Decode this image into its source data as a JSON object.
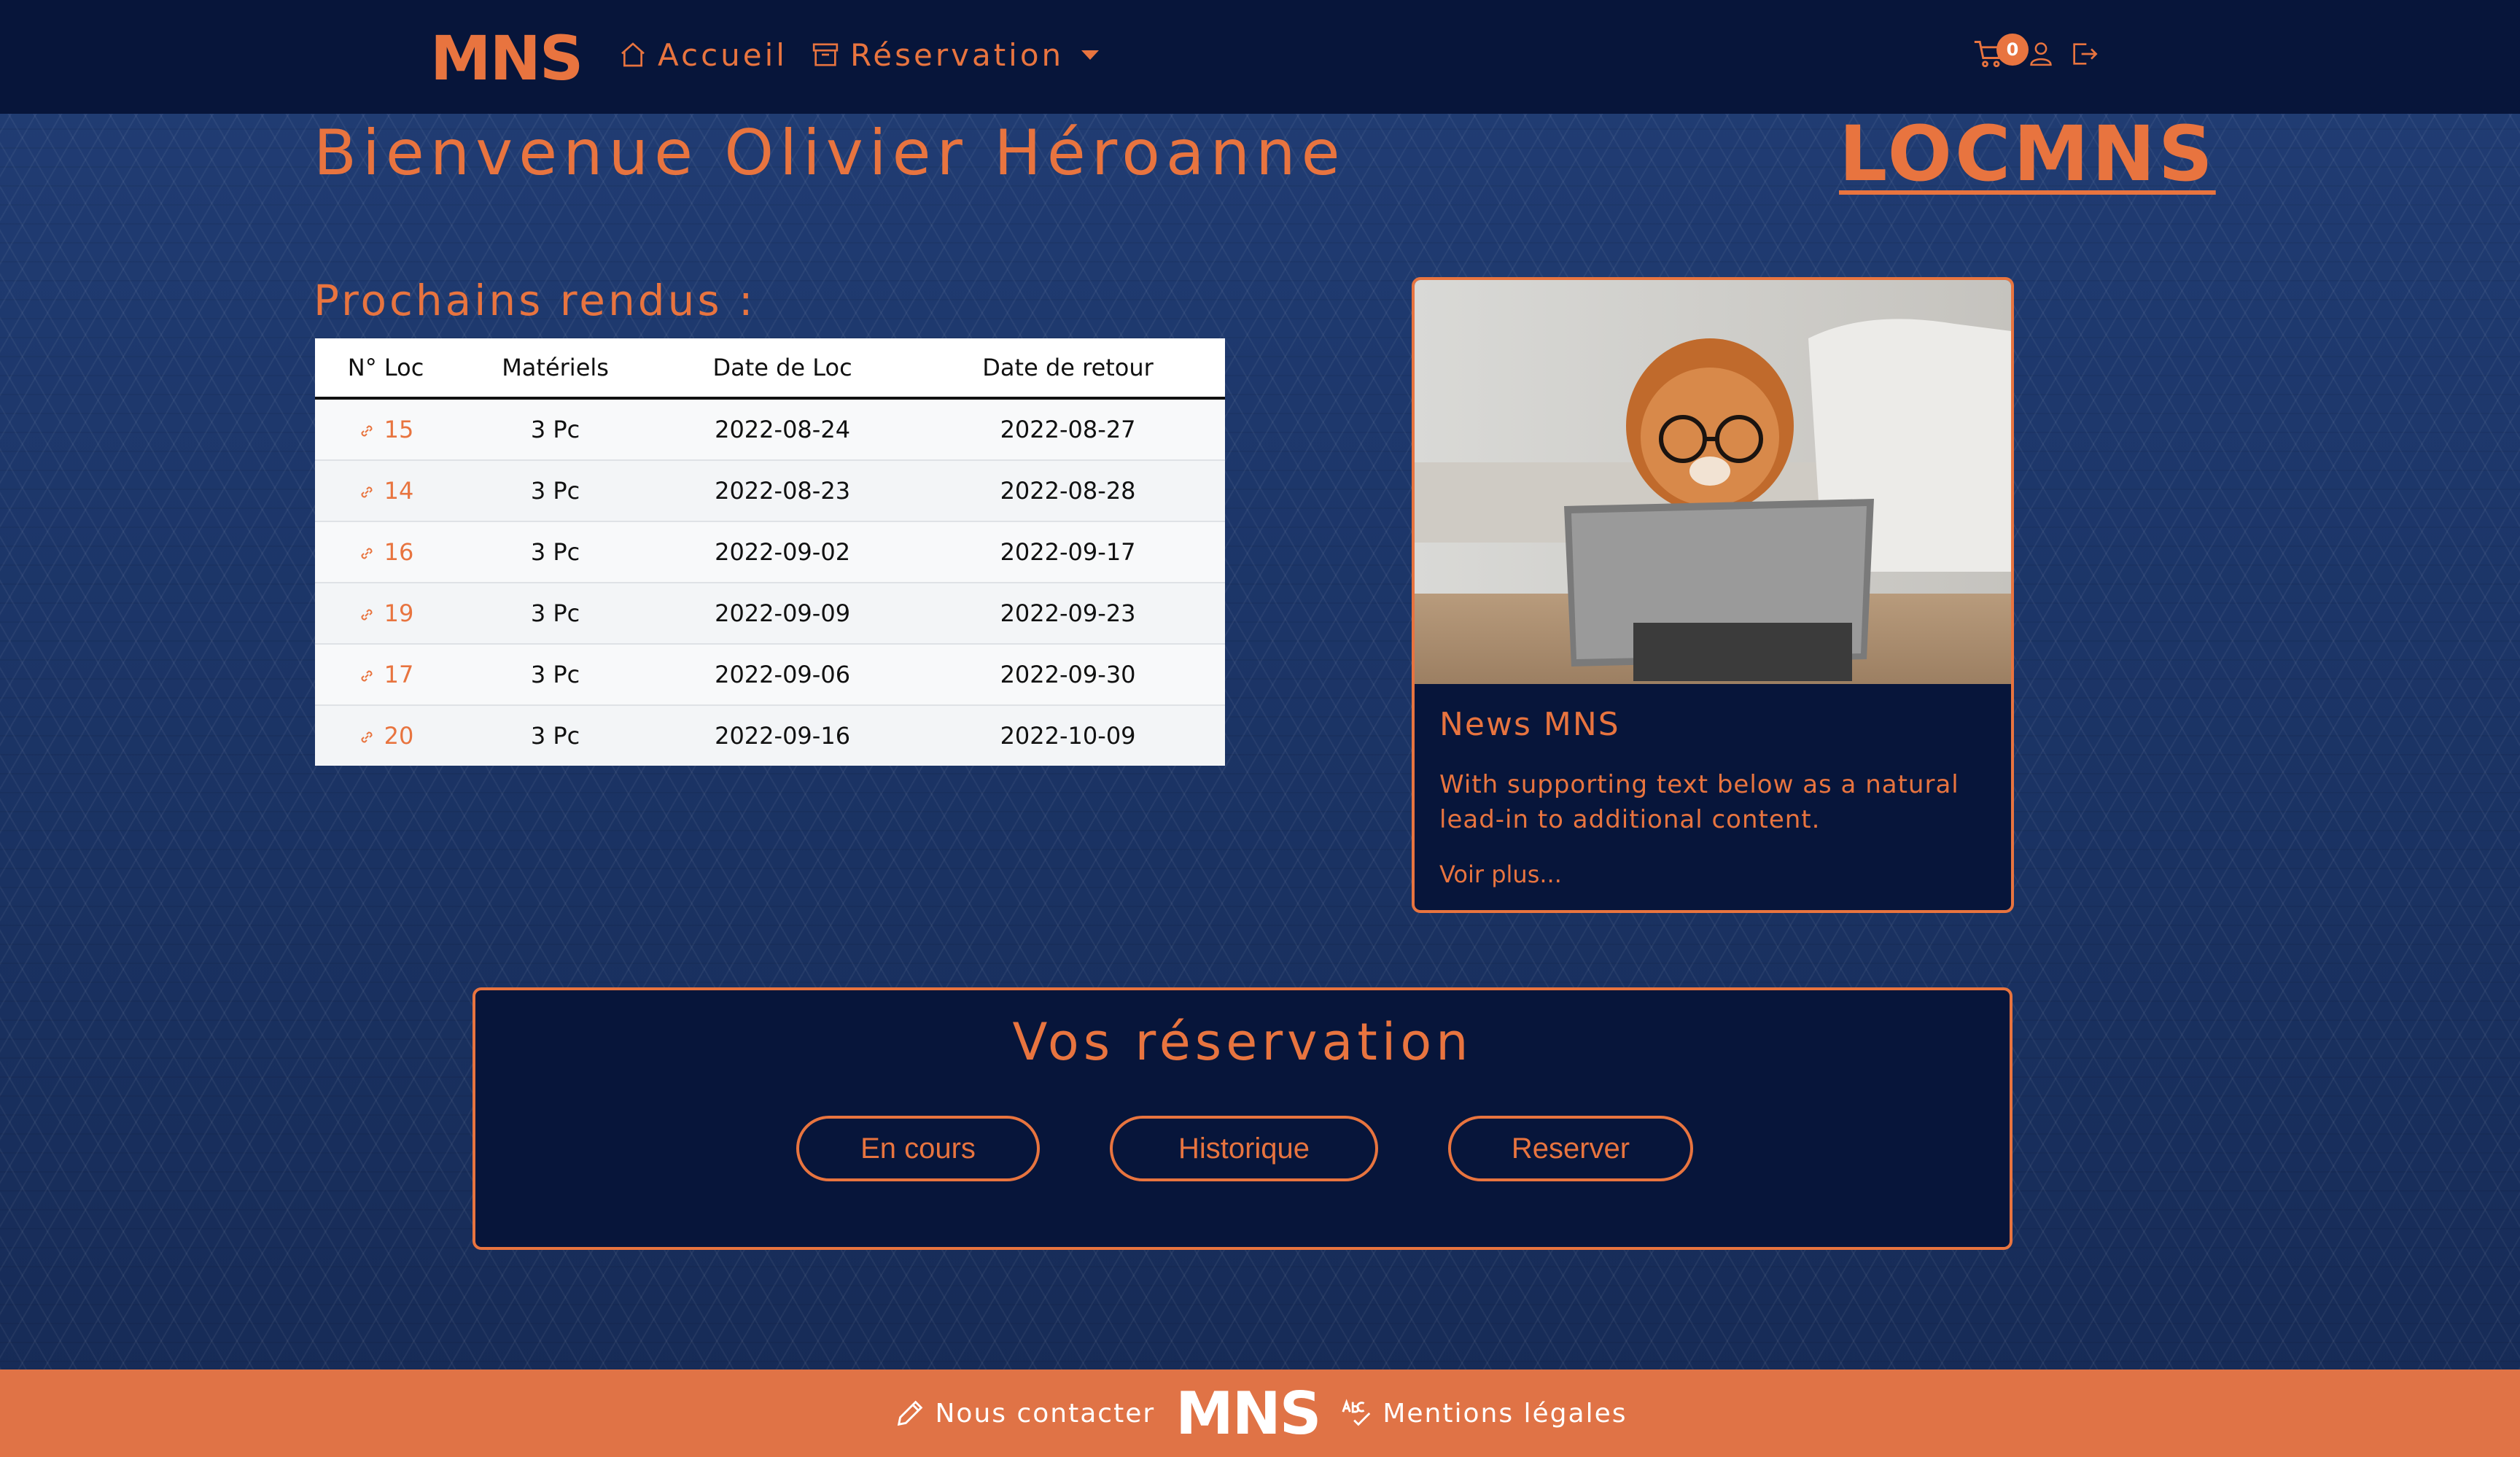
{
  "nav": {
    "brand": "MNS",
    "home_label": "Accueil",
    "reservation_label": "Réservation",
    "cart_count": "0"
  },
  "header": {
    "welcome": "Bienvenue Olivier Héroanne",
    "logo": "LOCMNS"
  },
  "upcoming": {
    "title": "Prochains rendus :",
    "columns": [
      "N° Loc",
      "Matériels",
      "Date de Loc",
      "Date de retour"
    ],
    "rows": [
      {
        "id": "15",
        "material": "3 Pc",
        "start": "2022-08-24",
        "end": "2022-08-27"
      },
      {
        "id": "14",
        "material": "3 Pc",
        "start": "2022-08-23",
        "end": "2022-08-28"
      },
      {
        "id": "16",
        "material": "3 Pc",
        "start": "2022-09-02",
        "end": "2022-09-17"
      },
      {
        "id": "19",
        "material": "3 Pc",
        "start": "2022-09-09",
        "end": "2022-09-23"
      },
      {
        "id": "17",
        "material": "3 Pc",
        "start": "2022-09-06",
        "end": "2022-09-30"
      },
      {
        "id": "20",
        "material": "3 Pc",
        "start": "2022-09-16",
        "end": "2022-10-09"
      }
    ]
  },
  "news": {
    "title": "News MNS",
    "text": "With supporting text below as a natural lead-in to additional content.",
    "more": "Voir plus..."
  },
  "reservations": {
    "title": "Vos réservation",
    "buttons": [
      "En cours",
      "Historique",
      "Reserver"
    ]
  },
  "footer": {
    "contact": "Nous contacter",
    "logo": "MNS",
    "legal": "Mentions légales"
  },
  "colors": {
    "accent": "#e8743f",
    "navy": "#07153a",
    "footer": "#e07346"
  }
}
